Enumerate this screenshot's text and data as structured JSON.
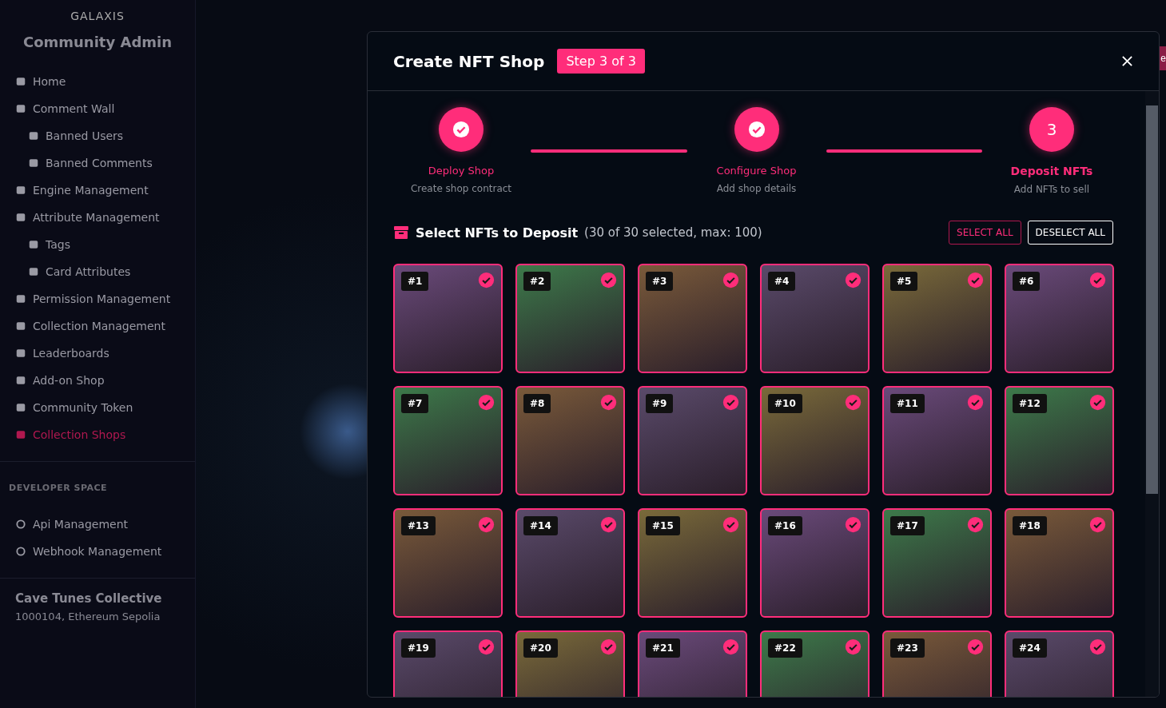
{
  "sidebar": {
    "logo": "GALAXIS",
    "title": "Community Admin",
    "items": [
      {
        "label": "Home",
        "selected": false
      },
      {
        "label": "Comment Wall",
        "selected": false,
        "children": [
          {
            "label": "Banned Users",
            "selected": false
          },
          {
            "label": "Banned Comments",
            "selected": false
          }
        ]
      },
      {
        "label": "Engine Management",
        "selected": false
      },
      {
        "label": "Attribute Management",
        "selected": false,
        "children": [
          {
            "label": "Tags",
            "selected": false
          },
          {
            "label": "Card Attributes",
            "selected": false
          }
        ]
      },
      {
        "label": "Permission Management",
        "selected": false
      },
      {
        "label": "Collection Management",
        "selected": false
      },
      {
        "label": "Leaderboards",
        "selected": false
      },
      {
        "label": "Add-on Shop",
        "selected": false
      },
      {
        "label": "Community Token",
        "selected": false
      },
      {
        "label": "Collection Shops",
        "selected": true
      }
    ],
    "section_title": "DEVELOPER SPACE",
    "dev_items": [
      {
        "label": "Api Management",
        "selected": false
      },
      {
        "label": "Webhook Management",
        "selected": false
      }
    ],
    "footer": {
      "name": "Cave Tunes Collective",
      "details": "1000104, Ethereum Sepolia"
    }
  },
  "background_button": {
    "label": "e"
  },
  "modal": {
    "title": "Create NFT Shop",
    "badge": "Step 3 of 3",
    "steps": [
      {
        "title": "Deploy Shop",
        "subtitle": "Create shop contract",
        "completed": true,
        "selected": false
      },
      {
        "title": "Configure Shop",
        "subtitle": "Add shop details",
        "completed": true,
        "selected": false
      },
      {
        "number": "3",
        "title": "Deposit NFTs",
        "subtitle": "Add NFTs to sell",
        "completed": false,
        "selected": true
      }
    ],
    "section_title": "Select NFTs to Deposit",
    "count": "(30 of 30 selected, max: 100)",
    "select_all": "SELECT ALL",
    "deselect_all": "DESELECT ALL",
    "nfts": [
      {
        "label": "#1",
        "selected": true
      },
      {
        "label": "#2",
        "selected": true
      },
      {
        "label": "#3",
        "selected": true
      },
      {
        "label": "#4",
        "selected": true
      },
      {
        "label": "#5",
        "selected": true
      },
      {
        "label": "#6",
        "selected": true
      },
      {
        "label": "#7",
        "selected": true
      },
      {
        "label": "#8",
        "selected": true
      },
      {
        "label": "#9",
        "selected": true
      },
      {
        "label": "#10",
        "selected": true
      },
      {
        "label": "#11",
        "selected": true
      },
      {
        "label": "#12",
        "selected": true
      },
      {
        "label": "#13",
        "selected": true
      },
      {
        "label": "#14",
        "selected": true
      },
      {
        "label": "#15",
        "selected": true
      },
      {
        "label": "#16",
        "selected": true
      },
      {
        "label": "#17",
        "selected": true
      },
      {
        "label": "#18",
        "selected": true
      },
      {
        "label": "#19",
        "selected": true
      },
      {
        "label": "#20",
        "selected": true
      },
      {
        "label": "#21",
        "selected": true
      },
      {
        "label": "#22",
        "selected": true
      },
      {
        "label": "#23",
        "selected": true
      },
      {
        "label": "#24",
        "selected": true
      }
    ]
  }
}
